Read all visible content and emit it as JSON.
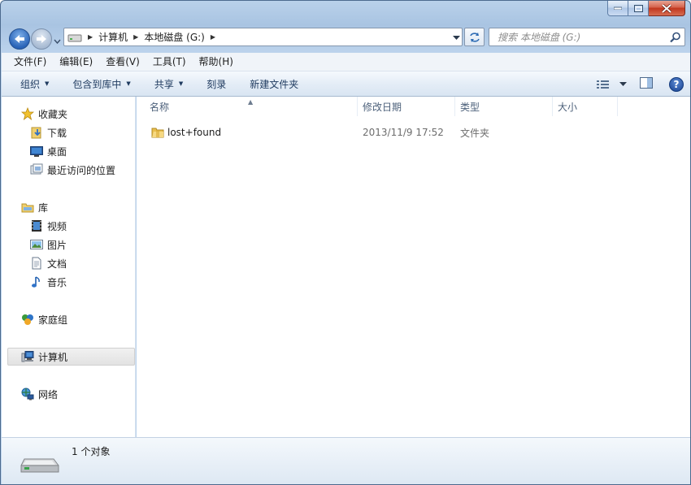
{
  "window": {
    "minimize_label": "",
    "maximize_label": "",
    "close_label": ""
  },
  "address": {
    "crumbs": [
      "计算机",
      "本地磁盘 (G:)"
    ]
  },
  "search": {
    "placeholder": "搜索 本地磁盘 (G:)"
  },
  "menu": {
    "items": [
      "文件(F)",
      "编辑(E)",
      "查看(V)",
      "工具(T)",
      "帮助(H)"
    ]
  },
  "toolbar": {
    "organize": "组织",
    "include_in_library": "包含到库中",
    "share": "共享",
    "burn": "刻录",
    "new_folder": "新建文件夹",
    "help": "?"
  },
  "nav": {
    "favorites": "收藏夹",
    "downloads": "下载",
    "desktop": "桌面",
    "recent": "最近访问的位置",
    "libraries": "库",
    "videos": "视频",
    "pictures": "图片",
    "documents": "文档",
    "music": "音乐",
    "homegroup": "家庭组",
    "computer": "计算机",
    "network": "网络"
  },
  "columns": {
    "name": "名称",
    "date": "修改日期",
    "type": "类型",
    "size": "大小"
  },
  "files": [
    {
      "name": "lost+found",
      "date": "2013/11/9 17:52",
      "type": "文件夹",
      "size": ""
    }
  ],
  "status": {
    "count": "1 个对象"
  },
  "colors": {
    "frame": "#b9d1ea",
    "close_red": "#c1361d",
    "accent_blue": "#2a64b8"
  }
}
